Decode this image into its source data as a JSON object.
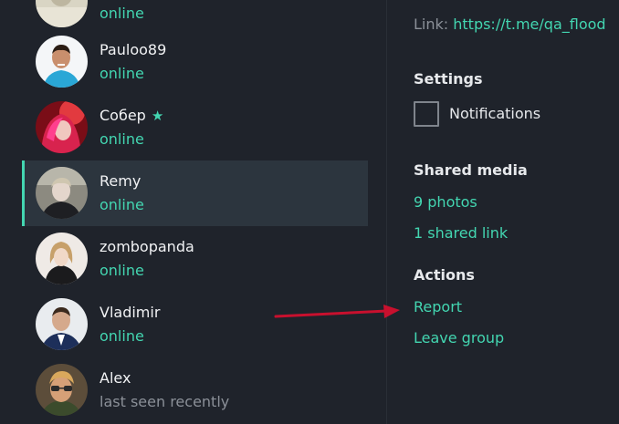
{
  "members": [
    {
      "name": "",
      "status": "online",
      "starred": false,
      "avatar": "avatar-partial"
    },
    {
      "name": "Pauloo89",
      "status": "online",
      "starred": false,
      "avatar": "avatar-pauloo89"
    },
    {
      "name": "Собер",
      "status": "online",
      "starred": true,
      "avatar": "avatar-sober"
    },
    {
      "name": "Remy",
      "status": "online",
      "starred": false,
      "selected": true,
      "avatar": "avatar-remy"
    },
    {
      "name": "zombopanda",
      "status": "online",
      "starred": false,
      "avatar": "avatar-zombopanda"
    },
    {
      "name": "Vladimir",
      "status": "online",
      "starred": false,
      "avatar": "avatar-vladimir"
    },
    {
      "name": "Alex",
      "status": "last seen recently",
      "starred": false,
      "avatar": "avatar-alex"
    }
  ],
  "star_icon": "★",
  "info": {
    "link_label": "Link:",
    "link_value": "https://t.me/qa_flood",
    "settings_title": "Settings",
    "notifications_label": "Notifications",
    "notifications_checked": false,
    "shared_media_title": "Shared media",
    "photos_link": "9 photos",
    "shared_link": "1 shared link",
    "actions_title": "Actions",
    "report_link": "Report",
    "leave_link": "Leave group"
  },
  "colors": {
    "background": "#1f232b",
    "selected_row": "#2c353e",
    "accent": "#43d6b1",
    "text": "#f1f2f4",
    "muted": "#8b9098",
    "annotation_arrow": "#c8102e"
  },
  "annotation": {
    "arrow_icon": "red-arrow-icon"
  }
}
